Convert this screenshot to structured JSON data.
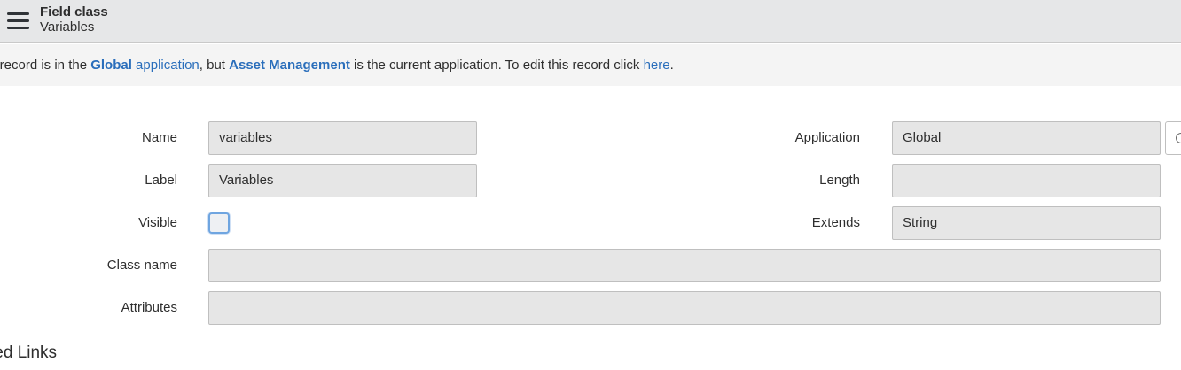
{
  "header": {
    "menu_icon": "hamburger-menu-icon",
    "title": "Field class",
    "subtitle": "Variables"
  },
  "notice": {
    "prefix": "s record is in the ",
    "app_link_bold": "Global",
    "app_link_rest": " application",
    "middle": ", but ",
    "current_app_link": "Asset Management",
    "suffix": " is the current application. To edit this record click ",
    "here_link": "here",
    "end": "."
  },
  "form": {
    "name_label": "Name",
    "name_value": "variables",
    "label_label": "Label",
    "label_value": "Variables",
    "visible_label": "Visible",
    "visible_checked": false,
    "class_name_label": "Class name",
    "class_name_value": "",
    "attributes_label": "Attributes",
    "attributes_value": "",
    "application_label": "Application",
    "application_value": "Global",
    "application_button_icon": "lookup-icon",
    "length_label": "Length",
    "length_value": "",
    "extends_label": "Extends",
    "extends_value": "String"
  },
  "related_links": {
    "title": "ted Links"
  },
  "colors": {
    "link": "#2a6ebb",
    "header_bg": "#e6e7e8",
    "notice_bg": "#f4f4f4",
    "readonly_input_bg": "#e6e6e6",
    "checkbox_focus": "#6fa5e0"
  }
}
